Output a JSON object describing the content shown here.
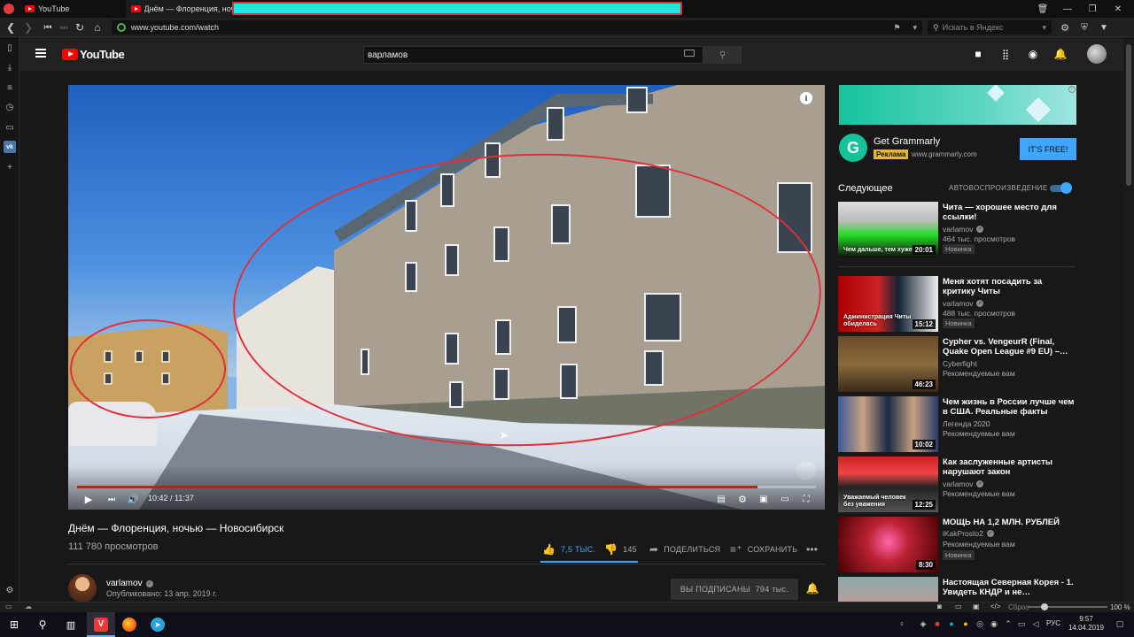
{
  "browser": {
    "tabs": [
      {
        "title": "YouTube"
      },
      {
        "title": "Днём — Флоренция, ночь"
      }
    ],
    "url": "www.youtube.com/watch",
    "search_placeholder": "Искать в Яндекс",
    "status_reset": "Сброс",
    "zoom": "100 %"
  },
  "youtube": {
    "logo_text": "YouTube",
    "search_value": "варламов"
  },
  "video": {
    "current_time": "10:42",
    "duration": "11:37",
    "progress": 0.921,
    "title": "Днём — Флоренция, ночью — Новосибирск",
    "views": "111 780 просмотров",
    "likes": "7,5 ТЫС.",
    "dislikes": "145",
    "share_label": "ПОДЕЛИТЬСЯ",
    "save_label": "СОХРАНИТЬ",
    "channel": "varlamov",
    "published": "Опубликовано: 13 апр. 2019 г.",
    "subscribe_label": "ВЫ ПОДПИСАНЫ",
    "subscribers": "794 тыс.",
    "accent_color": "#ff0000",
    "annotation_color": "#e0303a"
  },
  "ad": {
    "title": "Get Grammarly",
    "badge": "Реклама",
    "url": "www.grammarly.com",
    "cta": "IT'S FREE!",
    "logo_letter": "G"
  },
  "upnext": {
    "label": "Следующее",
    "autoplay_label": "АВТОВОСПРОИЗВЕДЕНИЕ",
    "autoplay_on": true,
    "items": [
      {
        "title": "Чита — хорошее место для ссылки!",
        "channel": "varlamov",
        "verified": true,
        "meta": "464 тыс. просмотров",
        "badge": "Новинка",
        "duration": "20:01",
        "thumb_text": "Чем дальше, тем хуже"
      },
      {
        "title": "Меня хотят посадить за критику Читы",
        "channel": "varlamov",
        "verified": true,
        "meta": "488 тыс. просмотров",
        "badge": "Новинка",
        "duration": "15:12",
        "thumb_text": "Администрация Читы обиделась"
      },
      {
        "title": "Cypher vs. VengeurR (Final, Quake Open League #9 EU) –…",
        "channel": "Cyberfight",
        "verified": false,
        "meta": "Рекомендуемые вам",
        "badge": "",
        "duration": "46:23",
        "thumb_text": ""
      },
      {
        "title": "Чем жизнь в России лучше чем в США. Реальные факты",
        "channel": "Легенда 2020",
        "verified": false,
        "meta": "Рекомендуемые вам",
        "badge": "",
        "duration": "10:02",
        "thumb_text": ""
      },
      {
        "title": "Как заслуженные артисты нарушают закон",
        "channel": "varlamov",
        "verified": true,
        "meta": "Рекомендуемые вам",
        "badge": "",
        "duration": "12:25",
        "thumb_text": "Уважаемый человек без уважения"
      },
      {
        "title": "МОЩЬ НА 1,2 МЛН. РУБЛЕЙ",
        "channel": "iKakProsto2",
        "verified": true,
        "meta": "Рекомендуемые вам",
        "badge": "Новинка",
        "duration": "8:30",
        "thumb_text": ""
      },
      {
        "title": "Настоящая Северная Корея - 1. Увидеть КНДР и не…",
        "channel": "",
        "verified": false,
        "meta": "",
        "badge": "",
        "duration": "",
        "thumb_text": ""
      }
    ]
  },
  "taskbar": {
    "lang": "РУС",
    "time": "9:57",
    "date": "14.04.2019"
  }
}
